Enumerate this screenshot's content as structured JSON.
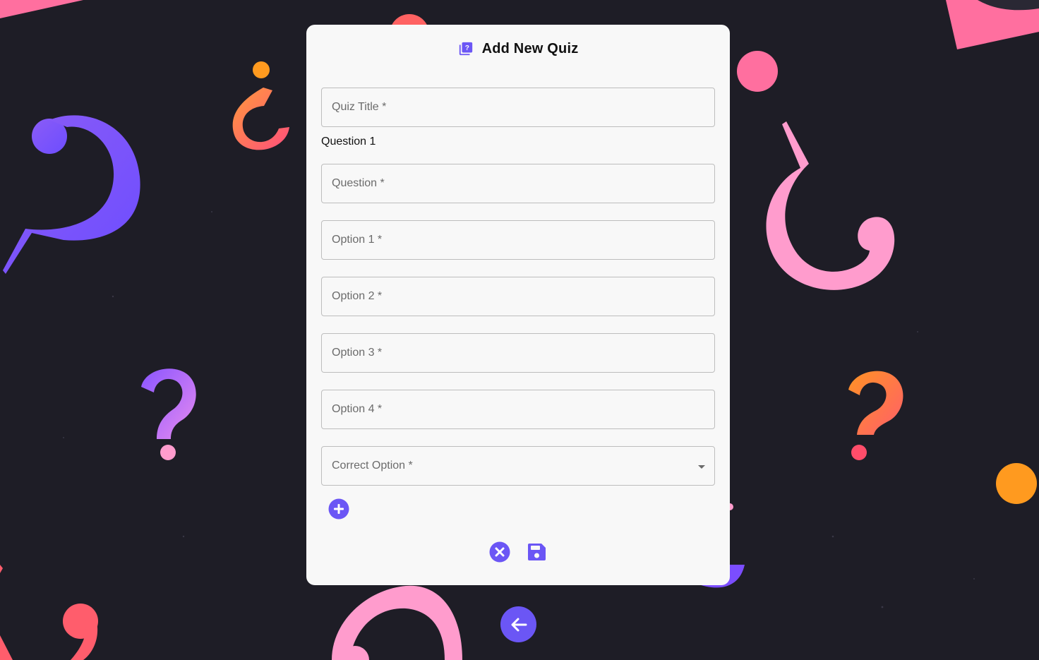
{
  "form": {
    "title": "Add New Quiz",
    "title_icon": "quiz-icon",
    "quiz_title_label": "Quiz Title *",
    "question_heading": "Question 1",
    "question_label": "Question *",
    "option1_label": "Option 1 *",
    "option2_label": "Option 2 *",
    "option3_label": "Option 3 *",
    "option4_label": "Option 4 *",
    "correct_option_label": "Correct Option *"
  },
  "actions": {
    "add_question_icon": "add-circle-icon",
    "cancel_icon": "cancel-circle-icon",
    "save_icon": "save-icon",
    "back_icon": "arrow-left-icon"
  },
  "colors": {
    "accent": "#6b56f5",
    "background": "#1e1d26",
    "card": "#f8f8f8",
    "pink": "#ff8fc6",
    "orange": "#ff9a1f",
    "coral": "#ff5d6c",
    "purple": "#7b4dff"
  }
}
